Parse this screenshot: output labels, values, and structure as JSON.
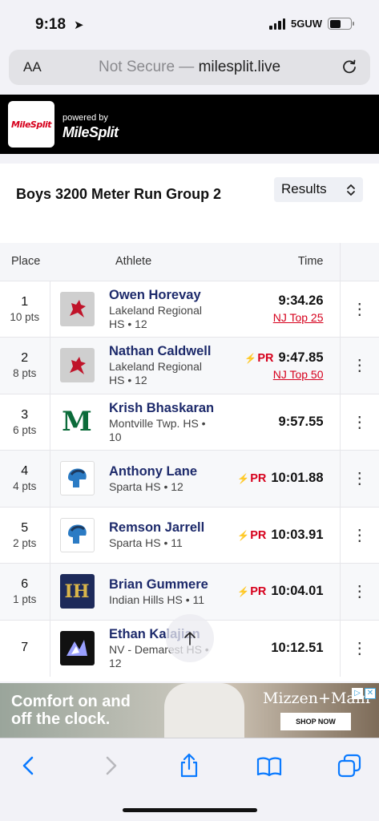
{
  "status_bar": {
    "time": "9:18",
    "network": "5GUW"
  },
  "browser": {
    "aa_label": "AA",
    "url_prefix": "Not Secure — ",
    "url_domain": "milesplit.live"
  },
  "brand": {
    "logo_text": "MileSplit",
    "powered_by": "powered by",
    "powered_logo": "MileSplit"
  },
  "event": {
    "title": "Boys 3200 Meter Run Group 2",
    "view_select": "Results"
  },
  "table": {
    "headers": {
      "place": "Place",
      "athlete": "Athlete",
      "time": "Time"
    },
    "rows": [
      {
        "place": "1",
        "points": "10 pts",
        "name": "Owen Horevay",
        "team": "Lakeland Regional HS • 12",
        "pr": "",
        "time": "9:34.26",
        "note": "NJ Top 25",
        "logo": "lakeland-logo"
      },
      {
        "place": "2",
        "points": "8 pts",
        "name": "Nathan Caldwell",
        "team": "Lakeland Regional HS • 12",
        "pr": "PR",
        "time": "9:47.85",
        "note": "NJ Top 50",
        "logo": "lakeland-logo"
      },
      {
        "place": "3",
        "points": "6 pts",
        "name": "Krish Bhaskaran",
        "team": "Montville Twp. HS • 10",
        "pr": "",
        "time": "9:57.55",
        "note": "",
        "logo": "montville-logo"
      },
      {
        "place": "4",
        "points": "4 pts",
        "name": "Anthony Lane",
        "team": "Sparta HS • 12",
        "pr": "PR",
        "time": "10:01.88",
        "note": "",
        "logo": "sparta-logo"
      },
      {
        "place": "5",
        "points": "2 pts",
        "name": "Remson Jarrell",
        "team": "Sparta HS • 11",
        "pr": "PR",
        "time": "10:03.91",
        "note": "",
        "logo": "sparta-logo"
      },
      {
        "place": "6",
        "points": "1 pts",
        "name": "Brian Gummere",
        "team": "Indian Hills HS • 11",
        "pr": "PR",
        "time": "10:04.01",
        "note": "",
        "logo": "indian-hills-logo"
      },
      {
        "place": "7",
        "points": "",
        "name": "Ethan Kalajian",
        "team": "NV - Demarest HS • 12",
        "pr": "",
        "time": "10:12.51",
        "note": "",
        "logo": "nv-demarest-logo"
      }
    ]
  },
  "ad": {
    "headline_1": "Comfort on and",
    "headline_2": "off the clock.",
    "brand": "Mizzen+Main",
    "cta": "SHOP NOW"
  },
  "colors": {
    "accent_red": "#d6001c",
    "name_navy": "#1d2a6b",
    "ios_blue": "#0a7aff"
  },
  "toolbar_icons": [
    "back-icon",
    "forward-icon",
    "share-icon",
    "bookmarks-icon",
    "tabs-icon"
  ]
}
